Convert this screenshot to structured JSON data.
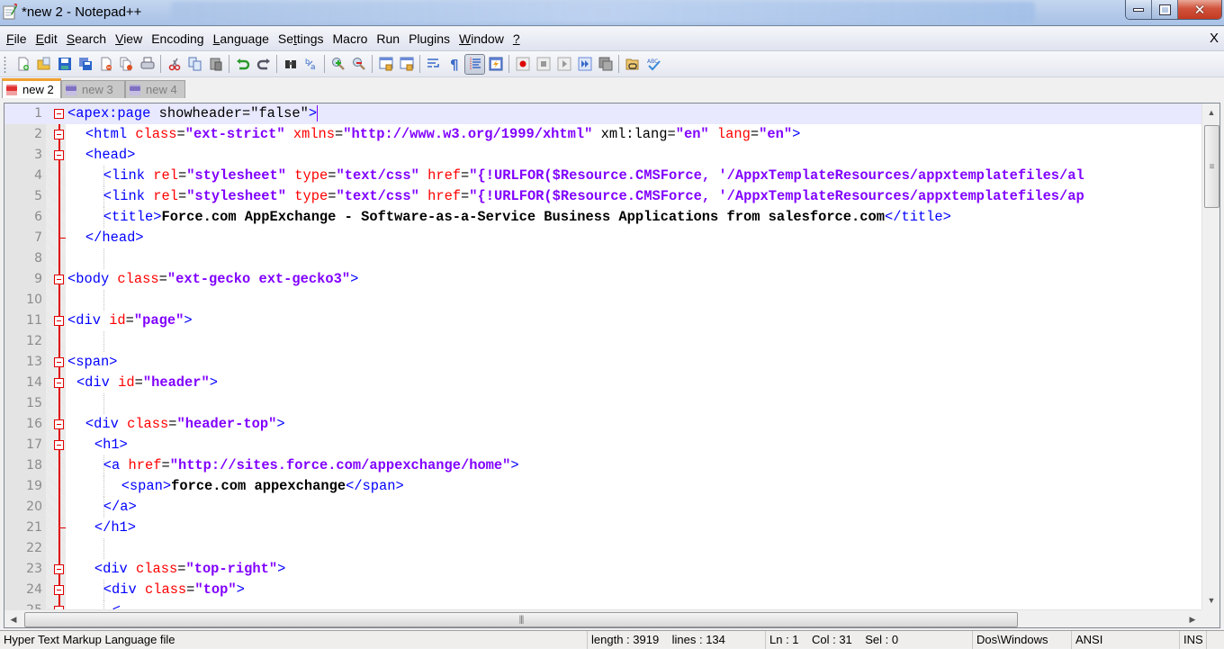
{
  "window": {
    "title": "*new  2 - Notepad++",
    "minimize_icon": "minimize-icon",
    "restore_icon": "restore-icon",
    "close_icon": "close-icon"
  },
  "menu": {
    "items": [
      {
        "label": "File",
        "u": "F",
        "rest": "ile"
      },
      {
        "label": "Edit",
        "u": "E",
        "rest": "dit"
      },
      {
        "label": "Search",
        "u": "S",
        "rest": "earch"
      },
      {
        "label": "View",
        "u": "V",
        "rest": "iew"
      },
      {
        "label": "Encoding",
        "u": "",
        "rest": "Encoding"
      },
      {
        "label": "Language",
        "u": "L",
        "rest": "anguage"
      },
      {
        "label": "Settings",
        "pre": "Se",
        "u": "t",
        "rest": "tings"
      },
      {
        "label": "Macro",
        "u": "",
        "rest": "Macro"
      },
      {
        "label": "Run",
        "u": "",
        "rest": "Run"
      },
      {
        "label": "Plugins",
        "u": "",
        "rest": "Plugins"
      },
      {
        "label": "Window",
        "u": "W",
        "rest": "indow"
      },
      {
        "label": "?",
        "u": "?",
        "rest": ""
      }
    ],
    "close_label": "X"
  },
  "toolbar": {
    "buttons": [
      "new-file",
      "open-file",
      "save",
      "save-all",
      "close",
      "close-all",
      "print",
      "cut",
      "copy",
      "paste",
      "undo",
      "redo",
      "find",
      "replace",
      "zoom-in",
      "zoom-out",
      "sync-vertical",
      "sync-horizontal",
      "word-wrap",
      "show-all-chars",
      "indent-guide",
      "user-defined-language",
      "macro-record",
      "macro-stop",
      "macro-play",
      "macro-run-multiple",
      "macro-save",
      "open-folder-link",
      "spell-check"
    ]
  },
  "tabs": [
    {
      "label": "new 2",
      "active": true,
      "color": "#e03030"
    },
    {
      "label": "new 3",
      "active": false,
      "color": "#8070c0"
    },
    {
      "label": "new 4",
      "active": false,
      "color": "#8070c0"
    }
  ],
  "editor": {
    "current_line": 1,
    "lines": [
      {
        "n": "1",
        "fold": "root",
        "indent": 0,
        "tokens": [
          [
            "tag",
            "<apex:page "
          ],
          [
            "plain",
            "showheader"
          ],
          [
            "plain",
            "=\"false\""
          ],
          [
            "tag",
            ">"
          ]
        ]
      },
      {
        "n": "2",
        "fold": "open",
        "indent": 2,
        "tokens": [
          [
            "tag",
            "<html "
          ],
          [
            "attr",
            "class"
          ],
          [
            "plain",
            "="
          ],
          [
            "val",
            "\"ext-strict\""
          ],
          [
            "plain",
            " "
          ],
          [
            "attr",
            "xmlns"
          ],
          [
            "plain",
            "="
          ],
          [
            "val",
            "\"http://www.w3.org/1999/xhtml\""
          ],
          [
            "plain",
            " xml:lang="
          ],
          [
            "val",
            "\"en\""
          ],
          [
            "plain",
            " "
          ],
          [
            "attr",
            "lang"
          ],
          [
            "plain",
            "="
          ],
          [
            "val",
            "\"en\""
          ],
          [
            "tag",
            ">"
          ]
        ]
      },
      {
        "n": "3",
        "fold": "open",
        "indent": 2,
        "tokens": [
          [
            "tag",
            "<head>"
          ]
        ]
      },
      {
        "n": "4",
        "fold": "",
        "indent": 4,
        "tokens": [
          [
            "tag",
            "<link "
          ],
          [
            "attr",
            "rel"
          ],
          [
            "plain",
            "="
          ],
          [
            "val",
            "\"stylesheet\""
          ],
          [
            "plain",
            " "
          ],
          [
            "attr",
            "type"
          ],
          [
            "plain",
            "="
          ],
          [
            "val",
            "\"text/css\""
          ],
          [
            "plain",
            " "
          ],
          [
            "attr",
            "href"
          ],
          [
            "plain",
            "="
          ],
          [
            "val",
            "\"{!URLFOR($Resource.CMSForce, '/AppxTemplateResources/appxtemplatefiles/al"
          ]
        ]
      },
      {
        "n": "5",
        "fold": "",
        "indent": 4,
        "tokens": [
          [
            "tag",
            "<link "
          ],
          [
            "attr",
            "rel"
          ],
          [
            "plain",
            "="
          ],
          [
            "val",
            "\"stylesheet\""
          ],
          [
            "plain",
            " "
          ],
          [
            "attr",
            "type"
          ],
          [
            "plain",
            "="
          ],
          [
            "val",
            "\"text/css\""
          ],
          [
            "plain",
            " "
          ],
          [
            "attr",
            "href"
          ],
          [
            "plain",
            "="
          ],
          [
            "val",
            "\"{!URLFOR($Resource.CMSForce, '/AppxTemplateResources/appxtemplatefiles/ap"
          ]
        ]
      },
      {
        "n": "6",
        "fold": "",
        "indent": 4,
        "tokens": [
          [
            "tag",
            "<title>"
          ],
          [
            "txt",
            "Force.com AppExchange - Software-as-a-Service Business Applications from salesforce.com"
          ],
          [
            "tag",
            "</title>"
          ]
        ]
      },
      {
        "n": "7",
        "fold": "end",
        "indent": 2,
        "tokens": [
          [
            "tag",
            "</head>"
          ]
        ]
      },
      {
        "n": "8",
        "fold": "",
        "indent": 0,
        "tokens": []
      },
      {
        "n": "9",
        "fold": "open",
        "indent": 0,
        "tokens": [
          [
            "tag",
            "<body "
          ],
          [
            "attr",
            "class"
          ],
          [
            "plain",
            "="
          ],
          [
            "val",
            "\"ext-gecko ext-gecko3\""
          ],
          [
            "tag",
            ">"
          ]
        ]
      },
      {
        "n": "10",
        "fold": "",
        "indent": 0,
        "tokens": []
      },
      {
        "n": "11",
        "fold": "open",
        "indent": 0,
        "tokens": [
          [
            "tag",
            "<div "
          ],
          [
            "attr",
            "id"
          ],
          [
            "plain",
            "="
          ],
          [
            "val",
            "\"page\""
          ],
          [
            "tag",
            ">"
          ]
        ]
      },
      {
        "n": "12",
        "fold": "",
        "indent": 0,
        "tokens": []
      },
      {
        "n": "13",
        "fold": "open",
        "indent": 0,
        "tokens": [
          [
            "tag",
            "<span>"
          ]
        ]
      },
      {
        "n": "14",
        "fold": "open",
        "indent": 1,
        "tokens": [
          [
            "tag",
            "<div "
          ],
          [
            "attr",
            "id"
          ],
          [
            "plain",
            "="
          ],
          [
            "val",
            "\"header\""
          ],
          [
            "tag",
            ">"
          ]
        ]
      },
      {
        "n": "15",
        "fold": "",
        "indent": 0,
        "tokens": []
      },
      {
        "n": "16",
        "fold": "open",
        "indent": 2,
        "tokens": [
          [
            "tag",
            "<div "
          ],
          [
            "attr",
            "class"
          ],
          [
            "plain",
            "="
          ],
          [
            "val",
            "\"header-top\""
          ],
          [
            "tag",
            ">"
          ]
        ]
      },
      {
        "n": "17",
        "fold": "open",
        "indent": 3,
        "tokens": [
          [
            "tag",
            "<h1>"
          ]
        ]
      },
      {
        "n": "18",
        "fold": "",
        "indent": 4,
        "tokens": [
          [
            "tag",
            "<a "
          ],
          [
            "attr",
            "href"
          ],
          [
            "plain",
            "="
          ],
          [
            "val",
            "\"http://sites.force.com/appexchange/home\""
          ],
          [
            "tag",
            ">"
          ]
        ]
      },
      {
        "n": "19",
        "fold": "",
        "indent": 6,
        "tokens": [
          [
            "tag",
            "<span>"
          ],
          [
            "txt",
            "force.com appexchange"
          ],
          [
            "tag",
            "</span>"
          ]
        ]
      },
      {
        "n": "20",
        "fold": "",
        "indent": 4,
        "tokens": [
          [
            "tag",
            "</a>"
          ]
        ]
      },
      {
        "n": "21",
        "fold": "end",
        "indent": 3,
        "tokens": [
          [
            "tag",
            "</h1>"
          ]
        ]
      },
      {
        "n": "22",
        "fold": "",
        "indent": 0,
        "tokens": []
      },
      {
        "n": "23",
        "fold": "open",
        "indent": 3,
        "tokens": [
          [
            "tag",
            "<div "
          ],
          [
            "attr",
            "class"
          ],
          [
            "plain",
            "="
          ],
          [
            "val",
            "\"top-right\""
          ],
          [
            "tag",
            ">"
          ]
        ]
      },
      {
        "n": "24",
        "fold": "open",
        "indent": 4,
        "tokens": [
          [
            "tag",
            "<div "
          ],
          [
            "attr",
            "class"
          ],
          [
            "plain",
            "="
          ],
          [
            "val",
            "\"top\""
          ],
          [
            "tag",
            ">"
          ]
        ]
      },
      {
        "n": "25",
        "fold": "open",
        "indent": 5,
        "tokens": [
          [
            "tag",
            "<"
          ]
        ]
      }
    ]
  },
  "statusbar": {
    "file_type": "Hyper Text Markup Language file",
    "length_lines": "length : 3919    lines : 134",
    "position": "Ln : 1    Col : 31    Sel : 0",
    "eol": "Dos\\Windows",
    "encoding": "ANSI",
    "mode": "INS"
  }
}
